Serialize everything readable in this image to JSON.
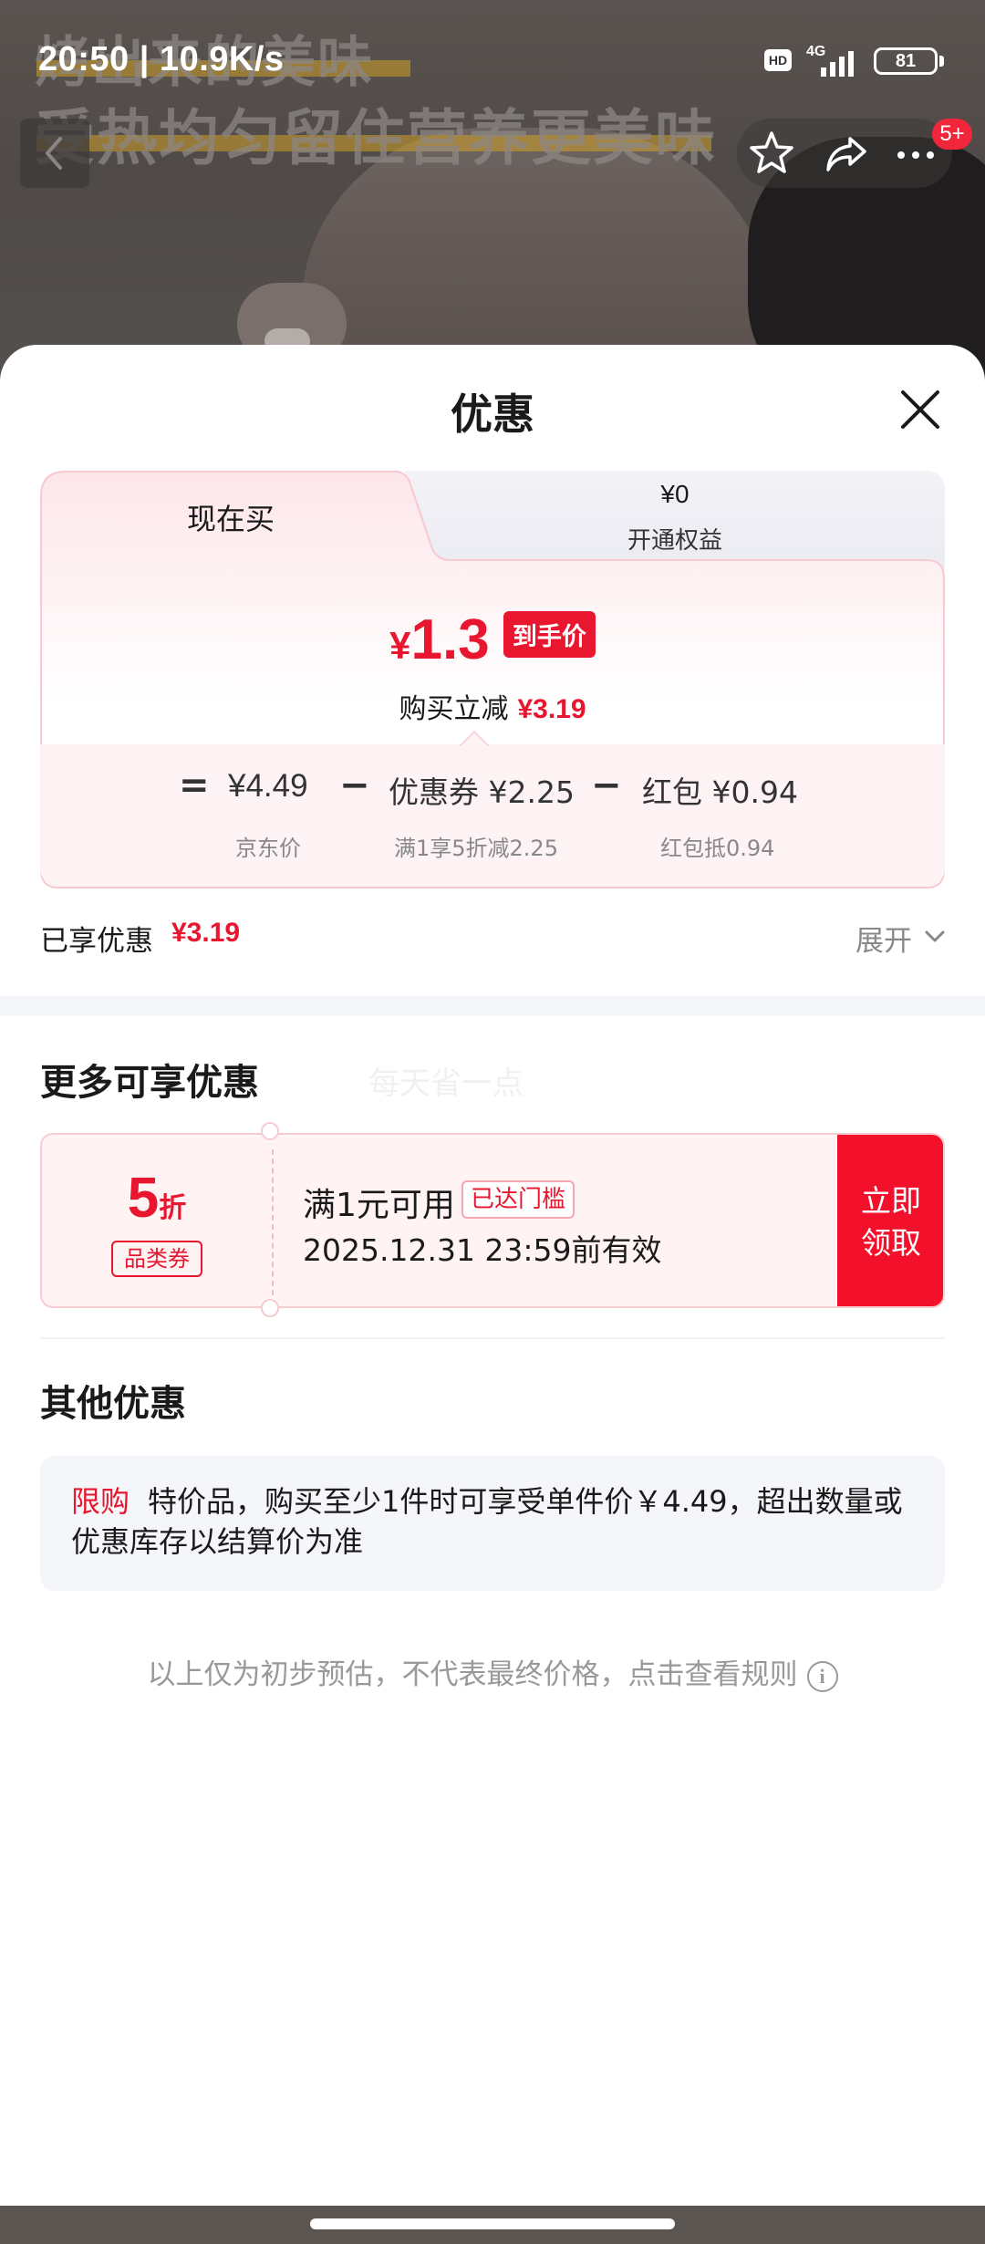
{
  "status_bar": {
    "time": "20:50 | 10.9K/s",
    "hd": "HD",
    "network": "4G",
    "battery": "81"
  },
  "background": {
    "line1": "烤出来的美味",
    "line2": "受热均匀留住营养更美味"
  },
  "nav": {
    "badge": "5+"
  },
  "sheet": {
    "title": "优惠"
  },
  "tabs": {
    "current": "现在买",
    "member_price": "¥0",
    "member_label": "开通权益"
  },
  "price": {
    "yen": "¥",
    "final": "1.3",
    "tag": "到手价",
    "reduce_label": "购买立减",
    "reduce_value": "¥3.19"
  },
  "formula": {
    "eq": "=",
    "jd_price": "¥4.49",
    "jd_label": "京东价",
    "minus1": "−",
    "coupon_text": "优惠券 ¥2.25",
    "coupon_label": "满1享5折减2.25",
    "minus2": "−",
    "redpack_text": "红包 ¥0.94",
    "redpack_label": "红包抵0.94"
  },
  "enjoyed": {
    "label": "已享优惠",
    "value": "¥3.19",
    "expand": "展开"
  },
  "more": {
    "title": "更多可享优惠",
    "subtitle": "每天省一点"
  },
  "coupon": {
    "discount": "5",
    "unit": "折",
    "type": "品类券",
    "condition": "满1元可用",
    "badge": "已达门槛",
    "expiry": "2025.12.31 23:59前有效",
    "button_line1": "立即",
    "button_line2": "领取"
  },
  "other": {
    "title": "其他优惠",
    "tag": "限购",
    "text": "特价品，购买至少1件时可享受单件价￥4.49，超出数量或优惠库存以结算价为准"
  },
  "disclaimer": "以上仅为初步预估，不代表最终价格，点击查看规则",
  "colors": {
    "accent": "#e8162e",
    "button": "#f2102a",
    "card_bg": "#fdf3f4",
    "muted": "#888888"
  },
  "icons": [
    "back-icon",
    "star-icon",
    "share-icon",
    "more-icon",
    "close-icon",
    "chevron-down-icon",
    "info-icon"
  ]
}
